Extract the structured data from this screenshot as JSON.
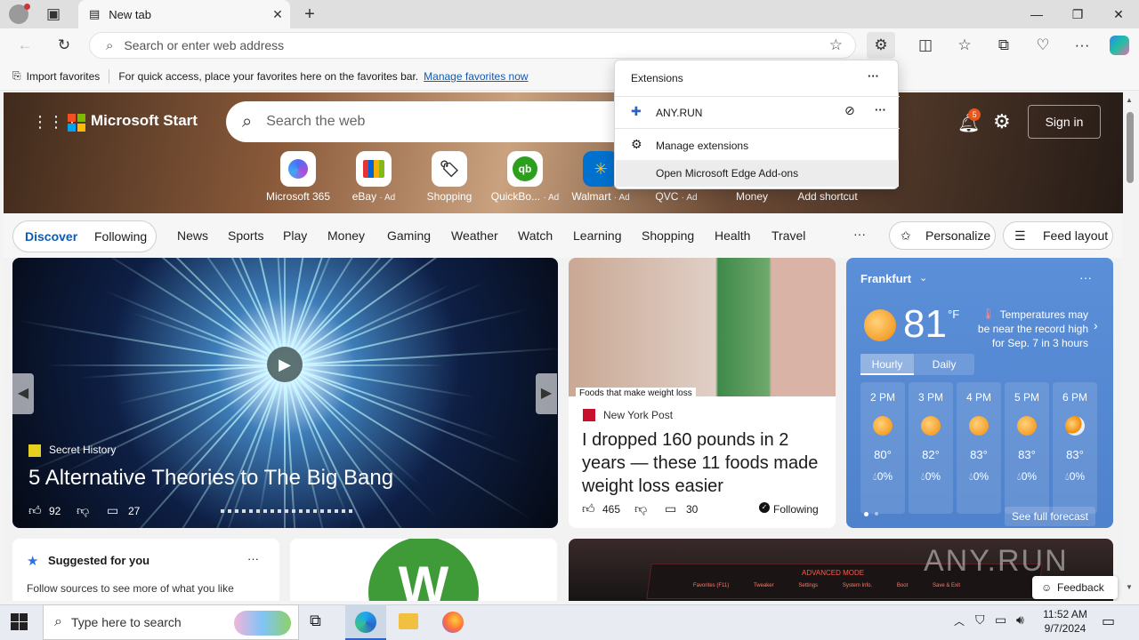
{
  "browser": {
    "tab_title": "New tab",
    "address_placeholder": "Search or enter web address",
    "favbar": {
      "import_label": "Import favorites",
      "hint": "For quick access, place your favorites here on the favorites bar.",
      "manage_link": "Manage favorites now"
    }
  },
  "extensions_popup": {
    "title": "Extensions",
    "extension_name": "ANY.RUN",
    "manage": "Manage extensions",
    "addons": "Open Microsoft Edge Add-ons"
  },
  "start": {
    "brand": "Microsoft Start",
    "search_placeholder": "Search the web",
    "notification_count": "5",
    "sign_in": "Sign in",
    "quicklinks": [
      {
        "label": "Microsoft 365",
        "ad": ""
      },
      {
        "label": "eBay",
        "ad": "· Ad"
      },
      {
        "label": "Shopping",
        "ad": ""
      },
      {
        "label": "QuickBo...",
        "ad": "· Ad"
      },
      {
        "label": "Walmart",
        "ad": "· Ad"
      },
      {
        "label": "QVC",
        "ad": "· Ad"
      },
      {
        "label": "Money",
        "ad": ""
      },
      {
        "label": "Add shortcut",
        "ad": ""
      }
    ],
    "nav": {
      "discover": "Discover",
      "following": "Following",
      "items": [
        "News",
        "Sports",
        "Play",
        "Money",
        "Gaming",
        "Weather",
        "Watch",
        "Learning",
        "Shopping",
        "Health",
        "Travel"
      ],
      "more": "···",
      "personalize": "Personalize",
      "feed_layout": "Feed layout"
    },
    "big_story": {
      "source": "Secret History",
      "headline": "5 Alternative Theories to The Big Bang",
      "likes": "92",
      "comments": "27"
    },
    "ny_story": {
      "image_caption": "Foods that make weight loss",
      "source": "New York Post",
      "headline": "I dropped 160 pounds in 2 years — these 11 foods made weight loss easier",
      "likes": "465",
      "comments": "30",
      "following": "Following"
    },
    "weather": {
      "city": "Frankfurt",
      "temp": "81",
      "unit": "°F",
      "alert": "Temperatures may be near the record high for Sep. 7 in 3 hours",
      "tab_hourly": "Hourly",
      "tab_daily": "Daily",
      "hours": [
        {
          "time": "2 PM",
          "temp": "80°",
          "precip": "0%"
        },
        {
          "time": "3 PM",
          "temp": "82°",
          "precip": "0%"
        },
        {
          "time": "4 PM",
          "temp": "83°",
          "precip": "0%"
        },
        {
          "time": "5 PM",
          "temp": "83°",
          "precip": "0%"
        },
        {
          "time": "6 PM",
          "temp": "83°",
          "precip": "0%"
        }
      ],
      "see_full": "See full forecast"
    },
    "suggested": {
      "title": "Suggested for you",
      "body": "Follow sources to see more of what you like"
    },
    "feedback": "Feedback",
    "game_menu": [
      "Favorites (F11)",
      "Tweaker",
      "Settings",
      "System Info.",
      "Boot",
      "Save & Exit"
    ],
    "game_header": "ADVANCED MODE"
  },
  "taskbar": {
    "search_placeholder": "Type here to search",
    "time": "11:52 AM",
    "date": "9/7/2024"
  },
  "watermark": "ANY.RUN"
}
